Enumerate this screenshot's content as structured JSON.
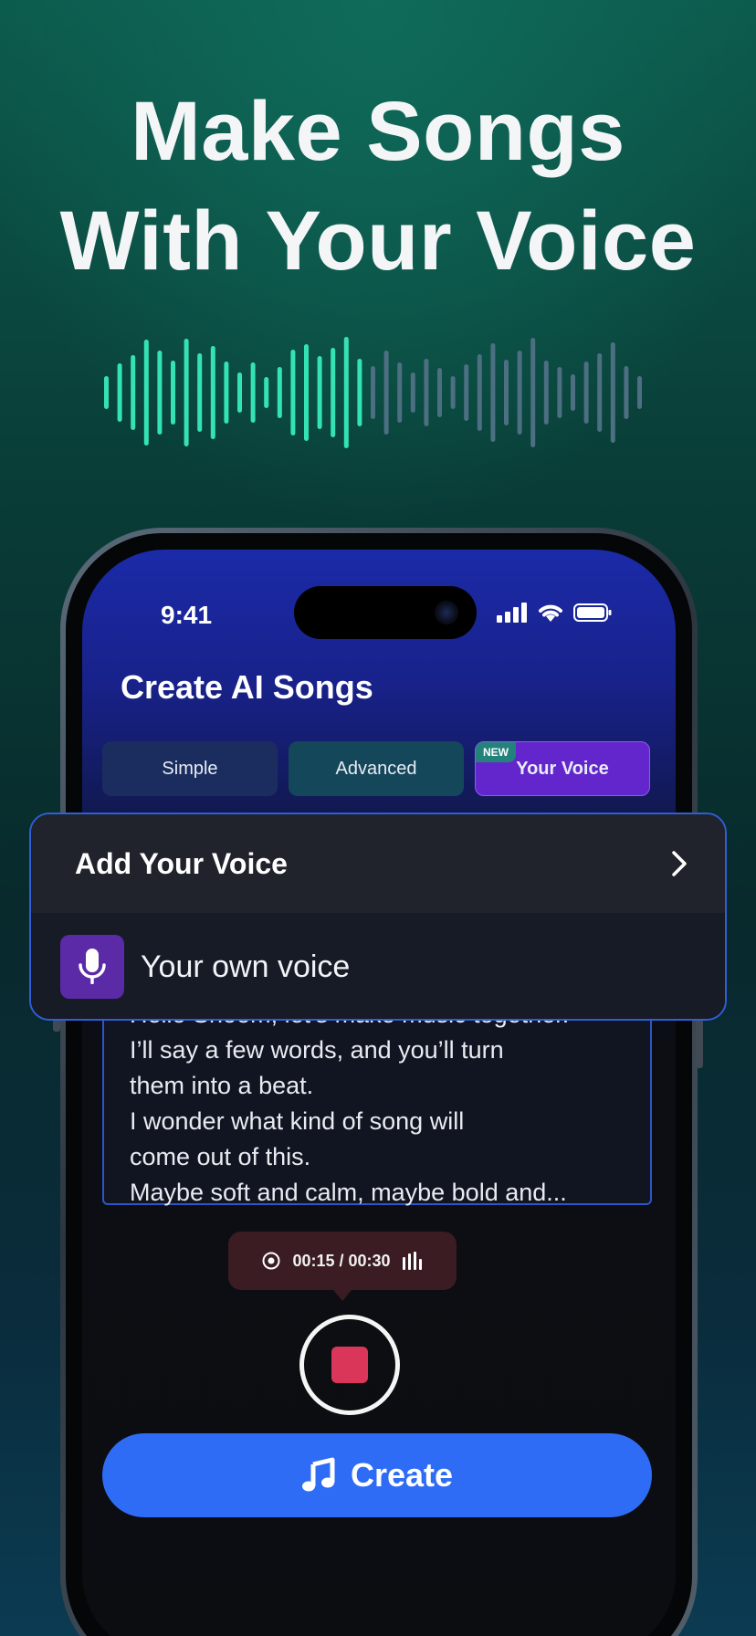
{
  "headline": {
    "line1": "Make Songs",
    "line2": "With Your Voice"
  },
  "colors": {
    "wave_left": "#34e3b4",
    "wave_right": "#4c6f82",
    "accent_blue": "#2f6cf6",
    "voice_tab": "#6326cc",
    "record_red": "#d9365a"
  },
  "status_bar": {
    "time": "9:41",
    "icons": [
      "signal-icon",
      "wifi-icon",
      "battery-icon"
    ]
  },
  "screen": {
    "title": "Create AI Songs",
    "tabs": [
      {
        "label": "Simple"
      },
      {
        "label": "Advanced"
      },
      {
        "label": "Your Voice",
        "badge": "NEW",
        "selected": true
      }
    ]
  },
  "voice_card": {
    "header": "Add Your Voice",
    "option_label": "Your own voice",
    "option_icon": "microphone-icon"
  },
  "lyrics": {
    "lines": [
      "Hello Shoom, let’s make music together.",
      "I’ll say a few words, and you’ll turn",
      "them into a beat.",
      "I wonder what kind of song will",
      "come out of this.",
      "Maybe soft and calm, maybe bold and..."
    ]
  },
  "recorder": {
    "timer_text": "00:15 / 00:30"
  },
  "create_button": {
    "label": "Create",
    "icon": "music-note-icon"
  }
}
